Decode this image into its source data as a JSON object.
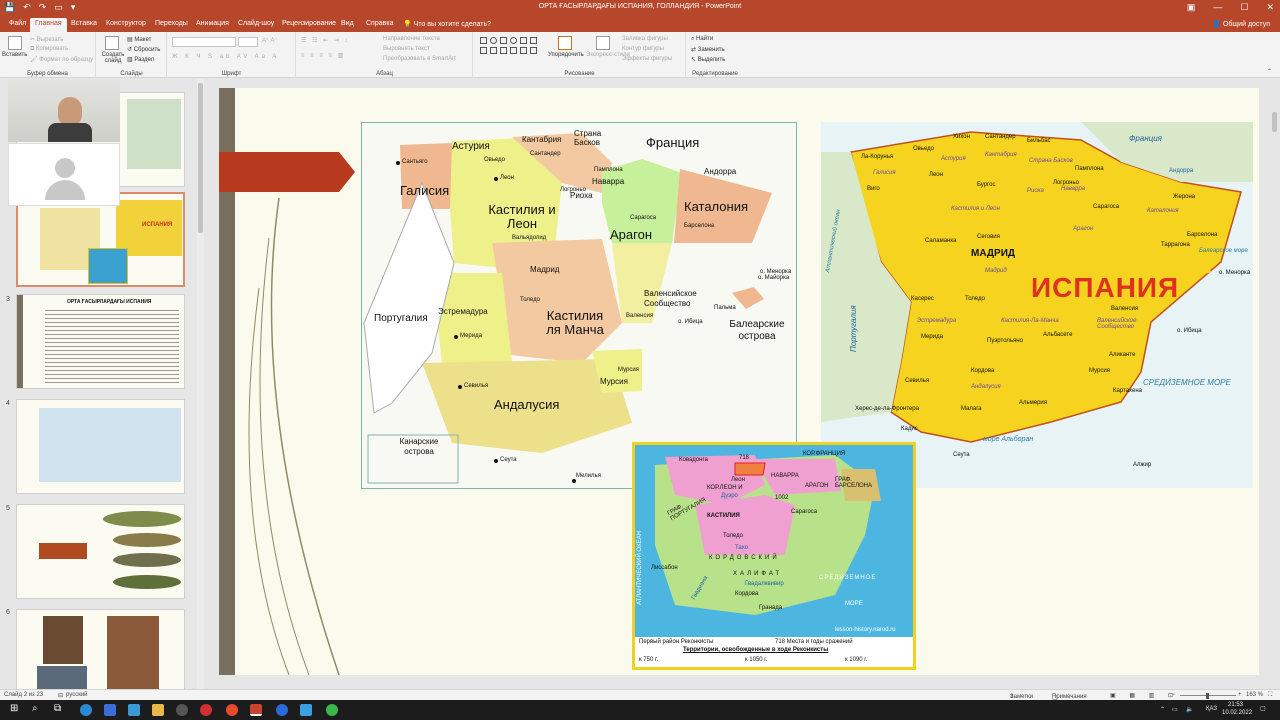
{
  "window": {
    "title": "ОРТА ҒАСЫРЛАРДАҒЫ ИСПАНИЯ, ГОЛЛАНДИЯ - PowerPoint"
  },
  "menu": {
    "tabs": [
      "Файл",
      "Главная",
      "Вставка",
      "Конструктор",
      "Переходы",
      "Анимация",
      "Слайд-шоу",
      "Рецензирование",
      "Вид",
      "Справка"
    ],
    "search": "Что вы хотите сделать?",
    "share": "Общий доступ"
  },
  "ribbon": {
    "clipboard": {
      "paste": "Вставить",
      "cut": "Вырезать",
      "copy": "Копировать",
      "format": "Формат по образцу",
      "label": "Буфер обмена"
    },
    "slides": {
      "new": "Создать слайд",
      "layout": "Макет",
      "reset": "Сбросить",
      "section": "Раздел",
      "label": "Слайды"
    },
    "font": {
      "label": "Шрифт"
    },
    "paragraph": {
      "direction": "Направление текста",
      "align": "Выровнять текст",
      "smartart": "Преобразовать в SmartArt",
      "label": "Абзац"
    },
    "drawing": {
      "arrange": "Упорядочить",
      "styles": "Экспресс-стили",
      "fill": "Заливка фигуры",
      "outline": "Контур фигуры",
      "effects": "Эффекты фигуры",
      "label": "Рисование"
    },
    "editing": {
      "find": "Найти",
      "replace": "Заменить",
      "select": "Выделить",
      "label": "Редактирование"
    }
  },
  "thumbnails": {
    "numbers": [
      "3",
      "4",
      "5",
      "6"
    ],
    "slide3_title": "ОРТА ҒАСЫРЛАРДАҒЫ ИСПАНИЯ",
    "slide2_label": "ИСПАНИЯ"
  },
  "map_left": {
    "regions": [
      {
        "name": "Астурия"
      },
      {
        "name": "Кантабрия"
      },
      {
        "name": "Страна Басков"
      },
      {
        "name": "Франция"
      },
      {
        "name": "Галисия"
      },
      {
        "name": "Наварра"
      },
      {
        "name": "Риоха"
      },
      {
        "name": "Андорра"
      },
      {
        "name": "Кастилия и Леон"
      },
      {
        "name": "Каталония"
      },
      {
        "name": "Арагон"
      },
      {
        "name": "Мадрид"
      },
      {
        "name": "Португалия"
      },
      {
        "name": "Эстремадура"
      },
      {
        "name": "Кастилия ля Манча"
      },
      {
        "name": "Валенсийское Сообщество"
      },
      {
        "name": "Балеарские острова"
      },
      {
        "name": "Мурсия"
      },
      {
        "name": "Андалусия"
      },
      {
        "name": "Канарские острова"
      }
    ],
    "cities": [
      "Сантьяго",
      "Овьедо",
      "Сантандер",
      "Леон",
      "Памплона",
      "Логроньо",
      "Вальядолид",
      "Сарагоса",
      "Барселона",
      "Толедо",
      "Мерида",
      "Валенсия",
      "Севилья",
      "Мурсия",
      "Пальма",
      "о. Майорка",
      "о. Менорка",
      "о. Ибица",
      "Сеута",
      "Мелилья"
    ]
  },
  "map_right": {
    "title": "ИСПАНИЯ",
    "cities": [
      "Хихон",
      "Сантандер",
      "Бильбас",
      "Ла-Корунья",
      "Овьедо",
      "Виго",
      "Леон",
      "Памплона",
      "Бургос",
      "Логроньо",
      "Жерона",
      "Сарагоса",
      "Барселона",
      "Таррагона",
      "Саламанка",
      "Сеговия",
      "МАДРИД",
      "Касерес",
      "Толедо",
      "Валенсия",
      "Мерида",
      "Пуэртольяно",
      "Альбасете",
      "Аликанте",
      "Мурсия",
      "Севилья",
      "Кордова",
      "Картахена",
      "Малага",
      "Альмерия",
      "Херес-де-ла-Фронтера",
      "Кадис",
      "Сеута",
      "Алжир"
    ],
    "regions": [
      "Галисия",
      "Астурия",
      "Кантабрия",
      "Страна Басков",
      "Наварра",
      "Риоха",
      "Кастилия и Леон",
      "Каталония",
      "Арагон",
      "Мадрид",
      "Эстремадура",
      "Кастилия-Ла-Манча",
      "Валенсийское Сообщество",
      "Андалусия"
    ],
    "countries": [
      "Франция",
      "Андорра",
      "Португалия"
    ],
    "seas": [
      "Атлантический океан",
      "Балеарское море",
      "СРЕДИЗЕМНОЕ МОРЕ",
      "море Альборан",
      "о. Менорка",
      "о. Ибица"
    ]
  },
  "map_reconquista": {
    "labels": [
      "Ковадонга",
      "718",
      "КОР.ФРАНЦИЯ",
      "НАВАРРА",
      "АРАГОН",
      "ГРАФ. БАРСЕЛОНА",
      "Леон",
      "КОР.ЛЕОН И",
      "1002",
      "ГРАФ. ПОРТУГАЛИЯ",
      "КАСТИЛИЯ",
      "Сарагоса",
      "Толедо",
      "Лиссабон",
      "КОРДОВСКИЙ",
      "ХАЛИФАТ",
      "СРЕДИЗЕМНОЕ",
      "МОРЕ",
      "Кордова",
      "Гранада",
      "АТЛАНТИЧЕСКИЙ ОКЕАН",
      "Дуэро",
      "Тахо",
      "Гвадиана",
      "Гвадалквивир",
      "lesson-history.narod.ru"
    ],
    "legend": {
      "first_area": "Первый район Реконкисты",
      "battles": "718 Места и годы сражений",
      "territories": "Территории, освобожденные в ходе Реконкисты",
      "y750": "к 750 г.",
      "y1050": "к 1050 г.",
      "y1090": "к 1090 г."
    }
  },
  "status": {
    "slide": "Слайд 2 из 23",
    "lang": "русский",
    "notes": "Заметки",
    "comments": "Примечания",
    "zoom": "163 %"
  },
  "taskbar": {
    "time": "21:53",
    "date": "10.02.2022",
    "lang": "ҚАЗ"
  },
  "colors": {
    "accent": "#b7472a",
    "ribbon_bg": "#f3f3f3"
  }
}
